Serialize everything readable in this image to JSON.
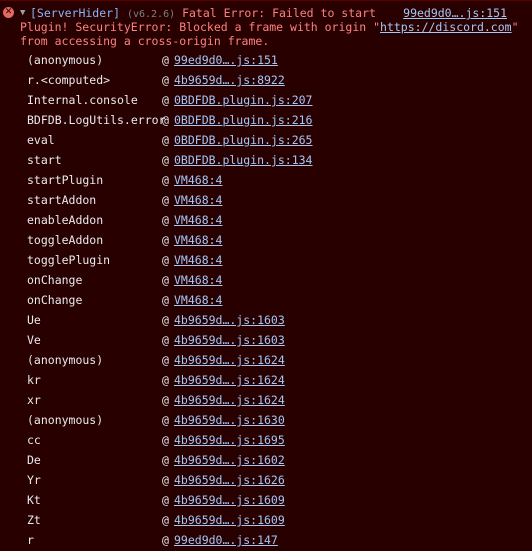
{
  "error": {
    "icon": "error-x-icon",
    "expand_arrow": "▼",
    "tag": "[ServerHider]",
    "version": "(v6.2.6)",
    "title": "Fatal Error: Failed to start",
    "source": "99ed9d0….js:151",
    "line2": "Plugin! SecurityError: Blocked a frame with origin \"",
    "line2_url": "https://discord.com",
    "line2_end": "\"",
    "line3": "from accessing a cross-origin frame."
  },
  "stack": [
    {
      "fn": "(anonymous)",
      "loc": "99ed9d0….js:151"
    },
    {
      "fn": "r.<computed>",
      "loc": "4b9659d….js:8922"
    },
    {
      "fn": "Internal.console",
      "loc": "0BDFDB.plugin.js:207"
    },
    {
      "fn": "BDFDB.LogUtils.error",
      "loc": "0BDFDB.plugin.js:216"
    },
    {
      "fn": "eval",
      "loc": "0BDFDB.plugin.js:265"
    },
    {
      "fn": "start",
      "loc": "0BDFDB.plugin.js:134"
    },
    {
      "fn": "startPlugin",
      "loc": "VM468:4"
    },
    {
      "fn": "startAddon",
      "loc": "VM468:4"
    },
    {
      "fn": "enableAddon",
      "loc": "VM468:4"
    },
    {
      "fn": "toggleAddon",
      "loc": "VM468:4"
    },
    {
      "fn": "togglePlugin",
      "loc": "VM468:4"
    },
    {
      "fn": "onChange",
      "loc": "VM468:4"
    },
    {
      "fn": "onChange",
      "loc": "VM468:4"
    },
    {
      "fn": "Ue",
      "loc": "4b9659d….js:1603"
    },
    {
      "fn": "Ve",
      "loc": "4b9659d….js:1603"
    },
    {
      "fn": "(anonymous)",
      "loc": "4b9659d….js:1624"
    },
    {
      "fn": "kr",
      "loc": "4b9659d….js:1624"
    },
    {
      "fn": "xr",
      "loc": "4b9659d….js:1624"
    },
    {
      "fn": "(anonymous)",
      "loc": "4b9659d….js:1630"
    },
    {
      "fn": "cc",
      "loc": "4b9659d….js:1695"
    },
    {
      "fn": "De",
      "loc": "4b9659d….js:1602"
    },
    {
      "fn": "Yr",
      "loc": "4b9659d….js:1626"
    },
    {
      "fn": "Kt",
      "loc": "4b9659d….js:1609"
    },
    {
      "fn": "Zt",
      "loc": "4b9659d….js:1609"
    },
    {
      "fn": "r",
      "loc": "99ed9d0….js:147"
    }
  ],
  "at_symbol": "@"
}
